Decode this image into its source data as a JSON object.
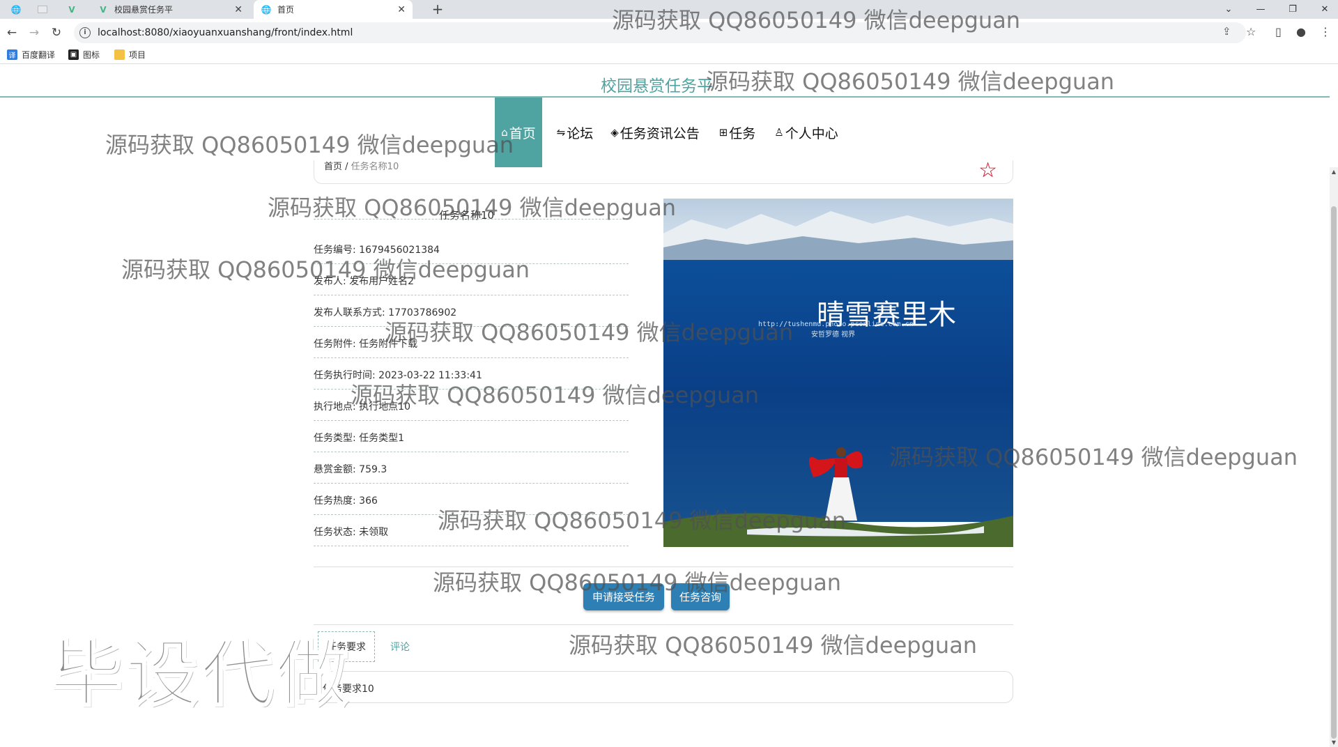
{
  "browser": {
    "tabs": [
      {
        "title": "",
        "pinned": true,
        "icon": "globe-icon"
      },
      {
        "title": "",
        "pinned": true,
        "icon": "image-icon"
      },
      {
        "title": "",
        "pinned": true,
        "icon": "vue-icon"
      },
      {
        "title": "校园悬赏任务平",
        "icon": "vue-icon",
        "active": false
      },
      {
        "title": "首页",
        "icon": "globe-icon",
        "active": true
      }
    ],
    "url": "localhost:8080/xiaoyuanxuanshang/front/index.html",
    "bookmarks": [
      {
        "label": "百度翻译",
        "icon": "translate-icon"
      },
      {
        "label": "图标",
        "icon": "image-icon"
      },
      {
        "label": "项目",
        "icon": "folder-icon"
      }
    ]
  },
  "site": {
    "title": "校园悬赏任务平",
    "menu": [
      {
        "label": "首页",
        "icon": "home-icon",
        "active": true
      },
      {
        "label": "论坛",
        "icon": "forum-icon",
        "active": false
      },
      {
        "label": "任务资讯公告",
        "icon": "news-icon",
        "active": false
      },
      {
        "label": "任务",
        "icon": "grid-icon",
        "active": false
      },
      {
        "label": "个人中心",
        "icon": "user-icon",
        "active": false
      }
    ]
  },
  "breadcrumb": {
    "home": "首页",
    "separator": " / ",
    "current": "任务名称10"
  },
  "detail": {
    "name": "任务名称10",
    "fields": [
      "任务编号: 1679456021384",
      "发布人: 发布用户姓名2",
      "发布人联系方式: 17703786902",
      "任务附件: 任务附件下载",
      "任务执行时间: 2023-03-22 11:33:41",
      "执行地点: 执行地点10",
      "任务类型: 任务类型1",
      "悬赏金额: 759.3",
      "任务热度: 366",
      "任务状态: 未领取"
    ],
    "photo_text": {
      "logo": "晴雪赛里木",
      "url": "http://tushenmu.photo.pconline.com.cn",
      "caption": "安哲罗德 视界"
    }
  },
  "actions": {
    "apply": "申请接受任务",
    "consult": "任务咨询"
  },
  "tabs": {
    "requirements": "任务要求",
    "comments": "评论"
  },
  "content": {
    "requirements": "任务要求10"
  },
  "watermarks": {
    "text": "源码获取 QQ86050149 微信deepguan",
    "big": "毕设代做"
  },
  "colors": {
    "accent": "#4fa3a0",
    "button": "#2e7fb3",
    "star": "#d0021b"
  }
}
